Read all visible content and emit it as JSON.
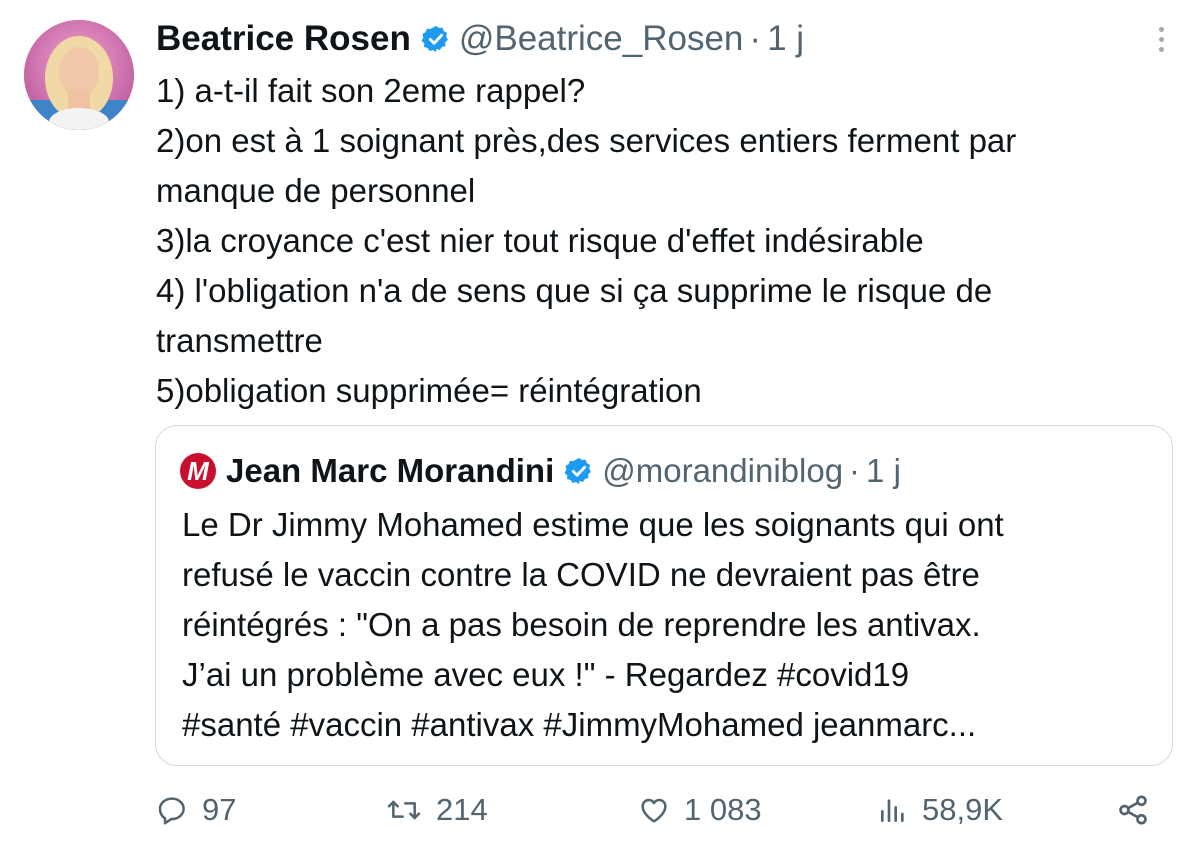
{
  "tweet": {
    "author_name": "Beatrice Rosen",
    "handle": "@Beatrice_Rosen",
    "separator": "·",
    "time": "1 j",
    "lines": [
      "1) a-t-il fait son 2eme rappel?",
      "2)on est à 1 soignant près,des services entiers ferment par",
      "manque de personnel",
      "3)la croyance c'est nier tout risque d'effet indésirable",
      "4) l'obligation n'a de sens que si ça supprime le risque de",
      "transmettre",
      "5)obligation supprimée= réintégration"
    ]
  },
  "quoted": {
    "logo_letter": "M",
    "author_name": "Jean Marc Morandini",
    "handle": "@morandiniblog",
    "separator": "·",
    "time": "1 j",
    "lines": [
      "Le Dr Jimmy Mohamed estime que les soignants qui ont",
      "refusé le vaccin contre la COVID ne devraient pas être",
      "réintégrés : \"On a pas besoin de reprendre les antivax.",
      "J’ai un problème avec eux !\" - Regardez #covid19",
      "#santé #vaccin #antivax #JimmyMohamed jeanmarc..."
    ]
  },
  "actions": {
    "replies": "97",
    "retweets": "214",
    "likes": "1 083",
    "views": "58,9K"
  },
  "colors": {
    "verified": "#1d9bf0",
    "muted": "#536471",
    "border": "#cfd9de",
    "logo_red": "#c8102e"
  },
  "icons": [
    "verified-badge-icon",
    "more-icon",
    "reply-icon",
    "retweet-icon",
    "like-icon",
    "views-icon",
    "share-icon"
  ]
}
